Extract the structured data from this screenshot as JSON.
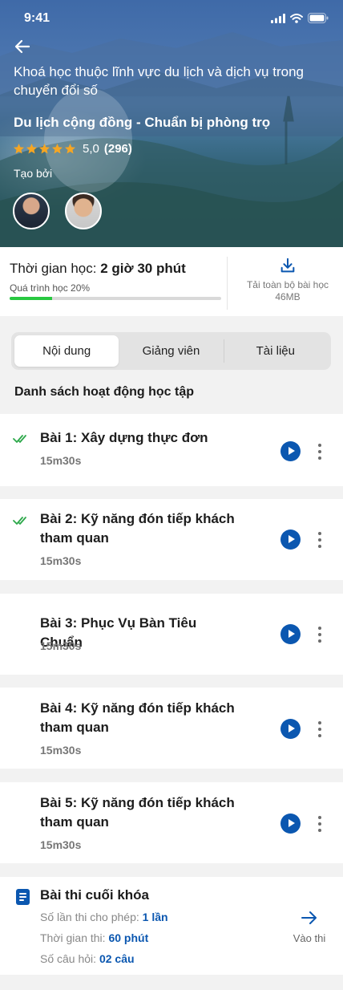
{
  "status_bar": {
    "time": "9:41"
  },
  "hero": {
    "category": "Khoá học thuộc lĩnh vực du lịch và dịch vụ trong chuyển đổi số",
    "title": "Du lịch cộng đồng - Chuẩn bị phòng trọ",
    "rating_value": "5,0",
    "rating_count": "(296)",
    "stars": 5,
    "created_by_label": "Tạo bởi"
  },
  "study": {
    "time_label": "Thời gian học:",
    "time_value": "2 giờ 30 phút",
    "progress_label": "Quá trình học 20%",
    "progress": 0.2,
    "download_label": "Tải toàn bộ bài học",
    "download_size": "46MB"
  },
  "tabs": [
    {
      "label": "Nội dung",
      "active": true
    },
    {
      "label": "Giảng viên",
      "active": false
    },
    {
      "label": "Tài liệu",
      "active": false
    }
  ],
  "section_title": "Danh sách hoạt động học tập",
  "lessons": [
    {
      "title": "Bài 1: Xây dựng thực đơn",
      "duration": "15m30s",
      "completed": true
    },
    {
      "title": "Bài 2: Kỹ năng đón tiếp khách tham quan",
      "duration": "15m30s",
      "completed": true
    },
    {
      "title": "Bài 3: Phục Vụ Bàn Tiêu Chuẩn",
      "duration": "15m30s",
      "completed": false
    },
    {
      "title": "Bài 4: Kỹ năng đón tiếp khách tham quan",
      "duration": "15m30s",
      "completed": false
    },
    {
      "title": "Bài 5: Kỹ năng đón tiếp khách tham quan",
      "duration": "15m30s",
      "completed": false
    }
  ],
  "exam": {
    "title": "Bài thi cuối khóa",
    "attempts_label": "Số lần thi cho phép:",
    "attempts_value": "1 lần",
    "time_label": "Thời gian thi:",
    "time_value": "60 phút",
    "questions_label": "Số câu hỏi:",
    "questions_value": "02 câu",
    "go_label": "Vào thi"
  },
  "colors": {
    "primary": "#0b57b0",
    "progress": "#28c840",
    "star": "#f6a623",
    "check": "#2ca84a"
  }
}
